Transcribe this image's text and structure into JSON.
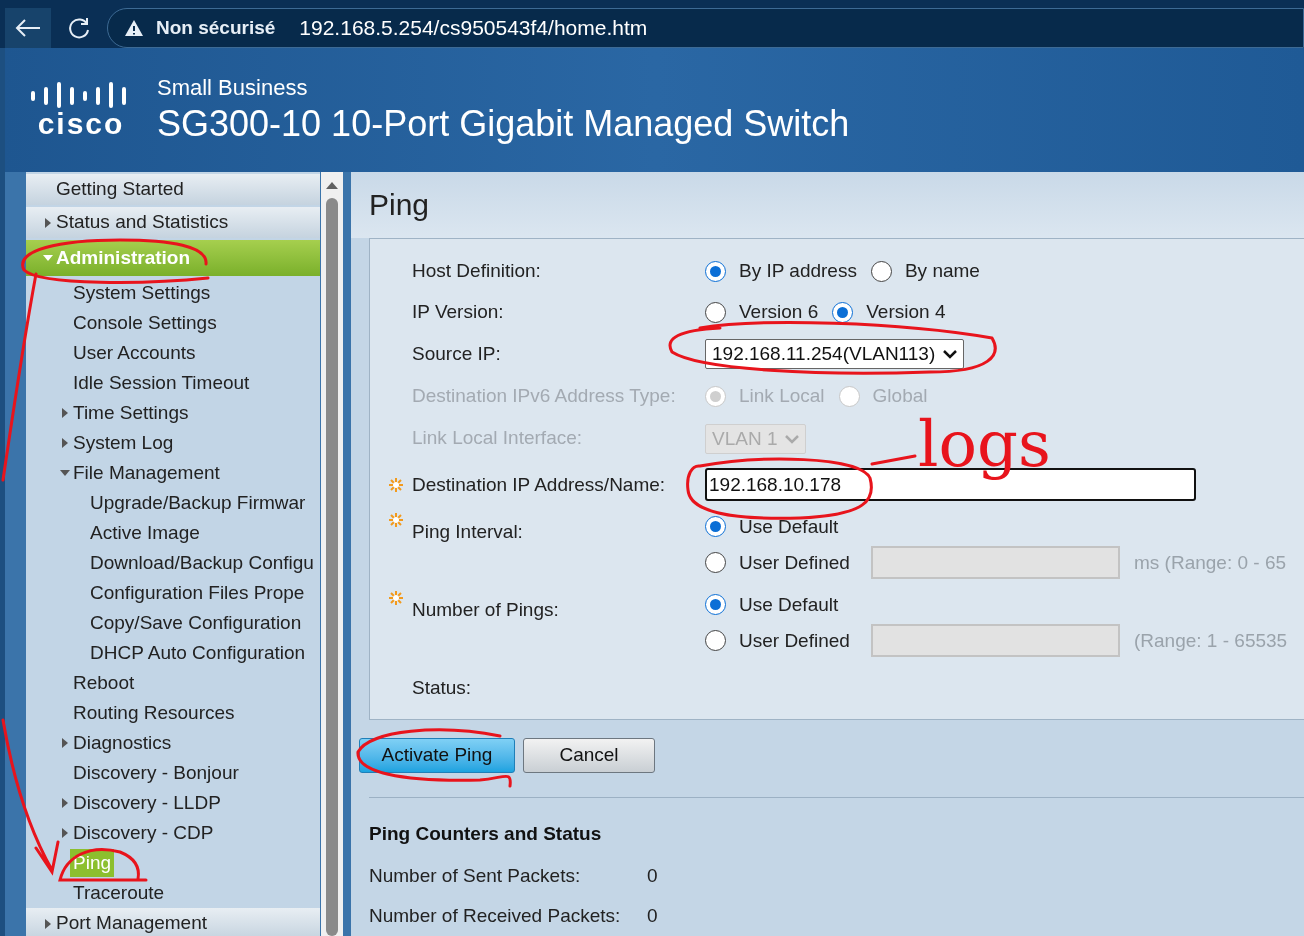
{
  "browser": {
    "security": "Non sécurisé",
    "url": "192.168.5.254/cs950543f4/home.htm"
  },
  "header": {
    "logo": "cisco",
    "subtitle": "Small Business",
    "title": "SG300-10 10-Port Gigabit Managed Switch"
  },
  "sidebar": {
    "items": [
      {
        "label": "Getting Started",
        "selected": false
      },
      {
        "label": "Status and Statistics",
        "expanded": false,
        "selected": false
      },
      {
        "label": "Administration",
        "expanded": true,
        "selected": false,
        "children": [
          {
            "label": "System Settings",
            "selected": false
          },
          {
            "label": "Console Settings",
            "selected": false
          },
          {
            "label": "User Accounts",
            "selected": false
          },
          {
            "label": "Idle Session Timeout",
            "selected": false
          },
          {
            "label": "Time Settings",
            "expanded": false,
            "selected": false
          },
          {
            "label": "System Log",
            "expanded": false,
            "selected": false
          },
          {
            "label": "File Management",
            "expanded": true,
            "selected": false,
            "children": [
              {
                "label": "Upgrade/Backup Firmwar",
                "selected": false
              },
              {
                "label": "Active Image",
                "selected": false
              },
              {
                "label": "Download/Backup Configu",
                "selected": false
              },
              {
                "label": "Configuration Files Prope",
                "selected": false
              },
              {
                "label": "Copy/Save Configuration",
                "selected": false
              },
              {
                "label": "DHCP Auto Configuration",
                "selected": false
              }
            ]
          },
          {
            "label": "Reboot",
            "selected": false
          },
          {
            "label": "Routing Resources",
            "selected": false
          },
          {
            "label": "Diagnostics",
            "expanded": false,
            "selected": false
          },
          {
            "label": "Discovery - Bonjour",
            "selected": false
          },
          {
            "label": "Discovery - LLDP",
            "expanded": false,
            "selected": false
          },
          {
            "label": "Discovery - CDP",
            "expanded": false,
            "selected": false
          },
          {
            "label": "Ping",
            "selected": true
          },
          {
            "label": "Traceroute",
            "selected": false
          }
        ]
      },
      {
        "label": "Port Management",
        "expanded": false,
        "selected": false
      }
    ]
  },
  "page_title": "Ping",
  "form": [
    {
      "kind": "radio",
      "label": "Host Definition:",
      "required": false,
      "disabled": false,
      "options": [
        {
          "label": "By IP address",
          "selected": true
        },
        {
          "label": "By name",
          "selected": false
        }
      ]
    },
    {
      "kind": "radio",
      "label": "IP Version:",
      "required": false,
      "disabled": false,
      "options": [
        {
          "label": "Version 6",
          "selected": false
        },
        {
          "label": "Version 4",
          "selected": true
        }
      ]
    },
    {
      "kind": "select",
      "label": "Source IP:",
      "required": false,
      "disabled": false,
      "value": "192.168.11.254(VLAN113)"
    },
    {
      "kind": "radio",
      "label": "Destination IPv6 Address Type:",
      "required": false,
      "disabled": true,
      "options": [
        {
          "label": "Link Local",
          "selected": true
        },
        {
          "label": "Global",
          "selected": false
        }
      ]
    },
    {
      "kind": "select",
      "label": "Link Local Interface:",
      "required": false,
      "disabled": true,
      "value": "VLAN 1"
    },
    {
      "kind": "text",
      "label": "Destination IP Address/Name:",
      "required": true,
      "disabled": false,
      "value": "192.168.10.178"
    },
    {
      "kind": "choice",
      "label": "Ping Interval:",
      "required": true,
      "disabled": false,
      "options": [
        {
          "label": "Use Default",
          "selected": true
        },
        {
          "label": "User Defined",
          "selected": false,
          "hint": "ms (Range: 0 - 65"
        }
      ]
    },
    {
      "kind": "choice",
      "label": "Number of Pings:",
      "required": true,
      "disabled": false,
      "options": [
        {
          "label": "Use Default",
          "selected": true
        },
        {
          "label": "User Defined",
          "selected": false,
          "hint": "(Range: 1 - 65535"
        }
      ]
    },
    {
      "kind": "status",
      "label": "Status:",
      "required": false,
      "disabled": false
    }
  ],
  "buttons": [
    {
      "label": "Activate Ping",
      "kind": "primary"
    },
    {
      "label": "Cancel",
      "kind": "secondary"
    }
  ],
  "counters": {
    "title": "Ping Counters and Status",
    "rows": [
      {
        "label": "Number of Sent Packets:",
        "value": "0"
      },
      {
        "label": "Number of Received Packets:",
        "value": "0"
      }
    ]
  },
  "annotation": {
    "note": "logs"
  }
}
